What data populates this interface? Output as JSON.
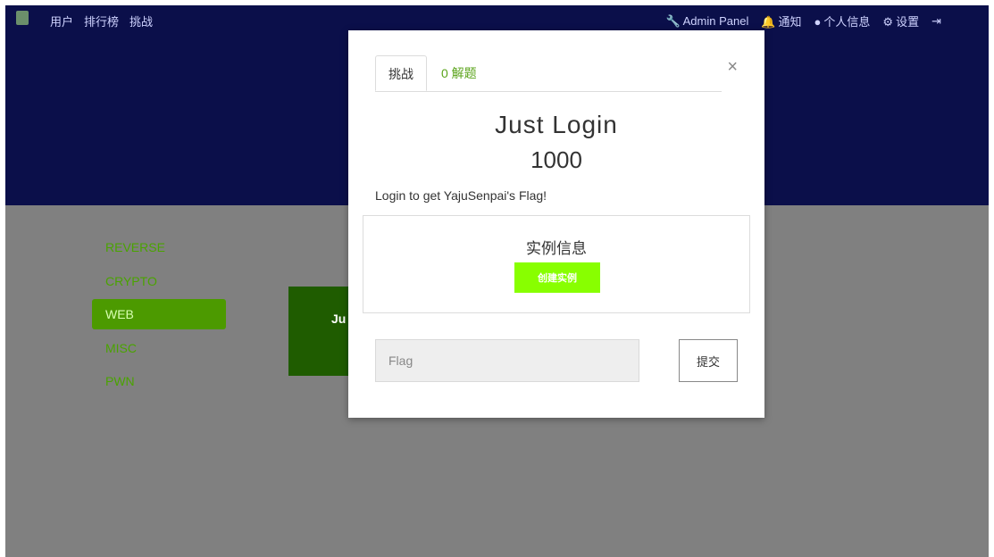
{
  "navbar": {
    "left_items": [
      "用户",
      "排行榜",
      "挑战"
    ],
    "right_items": [
      {
        "icon": "wrench-icon",
        "label": "Admin Panel"
      },
      {
        "icon": "bell-icon",
        "label": "通知"
      },
      {
        "icon": "user-icon",
        "label": "个人信息"
      },
      {
        "icon": "gears-icon",
        "label": "设置"
      },
      {
        "icon": "logout-icon",
        "label": ""
      }
    ]
  },
  "categories": [
    "REVERSE",
    "CRYPTO",
    "WEB",
    "MISC",
    "PWN"
  ],
  "active_category": "WEB",
  "background_card_text": "Ju",
  "modal": {
    "tab_challenge": "挑战",
    "tab_solves": "0 解题",
    "close": "×",
    "title": "Just Login",
    "score": "1000",
    "description": "Login to get YajuSenpai's Flag!",
    "instance_title": "实例信息",
    "create_instance": "创建实例",
    "flag_placeholder": "Flag",
    "submit": "提交"
  },
  "colors": {
    "navbar": "#0b0f4a",
    "accent_green": "#5aa31a",
    "create_button": "#88ff00",
    "active_category": "#4c9a00"
  }
}
